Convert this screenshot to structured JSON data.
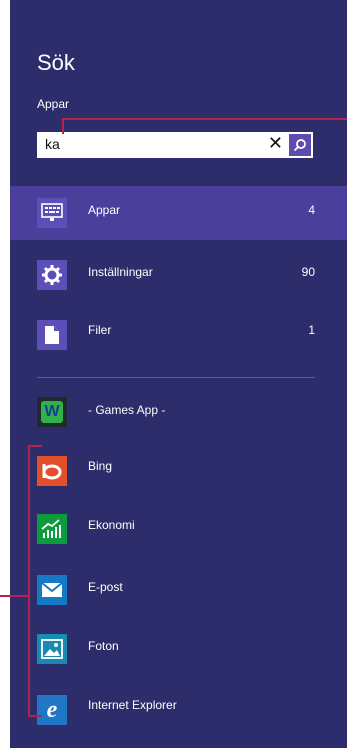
{
  "search_panel": {
    "title": "Sök",
    "scope_label": "Appar",
    "query": "ka",
    "clear_glyph": "✕"
  },
  "categories": [
    {
      "label": "Appar",
      "count": "4",
      "icon": "keyboard-monitor-icon",
      "selected": true
    },
    {
      "label": "Inställningar",
      "count": "90",
      "icon": "gear-icon"
    },
    {
      "label": "Filer",
      "count": "1",
      "icon": "file-icon"
    }
  ],
  "results": [
    {
      "label": "- Games App -",
      "icon": "games-app-icon"
    },
    {
      "label": "Bing",
      "icon": "bing-icon"
    },
    {
      "label": "Ekonomi",
      "icon": "ekonomi-chart-icon"
    },
    {
      "label": "E-post",
      "icon": "mail-icon"
    },
    {
      "label": "Foton",
      "icon": "photos-icon"
    },
    {
      "label": "Internet Explorer",
      "icon": "internet-explorer-icon"
    }
  ],
  "colors": {
    "pane": "#2d2d6b",
    "selected_row": "#4a3f9a",
    "search_button": "#5e4bb0",
    "callout": "#b5234d"
  }
}
